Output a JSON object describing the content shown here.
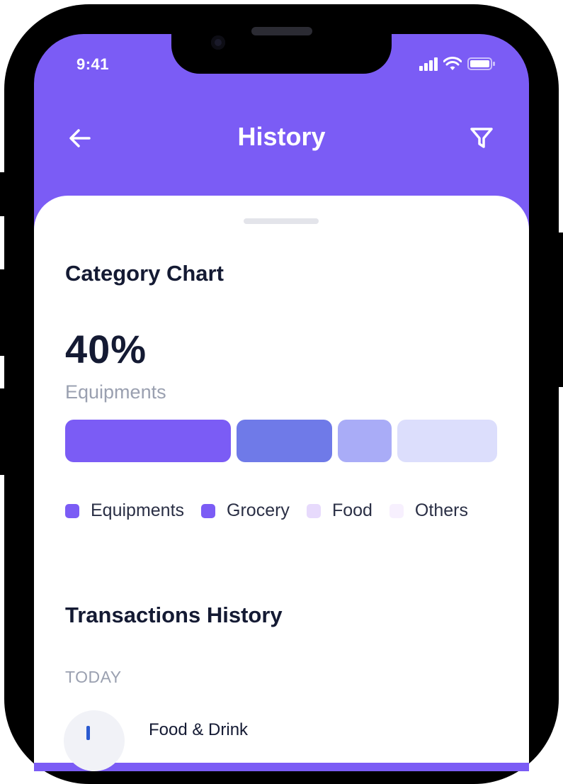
{
  "status_bar": {
    "time": "9:41",
    "icons": [
      "signal-icon",
      "wifi-icon",
      "battery-icon"
    ]
  },
  "header": {
    "title": "History",
    "back_icon": "arrow-left-icon",
    "filter_icon": "filter-icon"
  },
  "category_chart": {
    "title": "Category Chart",
    "highlight_percent": "40%",
    "highlight_label": "Equipments",
    "segments": [
      {
        "name": "Equipments",
        "share": 0.4,
        "color": "#7b5cf5"
      },
      {
        "name": "Grocery",
        "share": 0.23,
        "color": "#6f7ae8"
      },
      {
        "name": "Food",
        "share": 0.13,
        "color": "#a9acf7"
      },
      {
        "name": "Others",
        "share": 0.24,
        "color": "#dcdefc"
      }
    ],
    "legend": [
      {
        "label": "Equipments",
        "color": "#7b5cf5"
      },
      {
        "label": "Grocery",
        "color": "#7b5cf5"
      },
      {
        "label": "Food",
        "color": "#e7dafc"
      },
      {
        "label": "Others",
        "color": "#f7f0fe"
      }
    ]
  },
  "transactions": {
    "title": "Transactions History",
    "groups": [
      {
        "label": "TODAY",
        "items": [
          {
            "title": "Food & Drink"
          }
        ]
      }
    ]
  },
  "colors": {
    "accent": "#7b5cf5",
    "text_primary": "#141a33",
    "text_secondary": "#9aa0b0"
  }
}
